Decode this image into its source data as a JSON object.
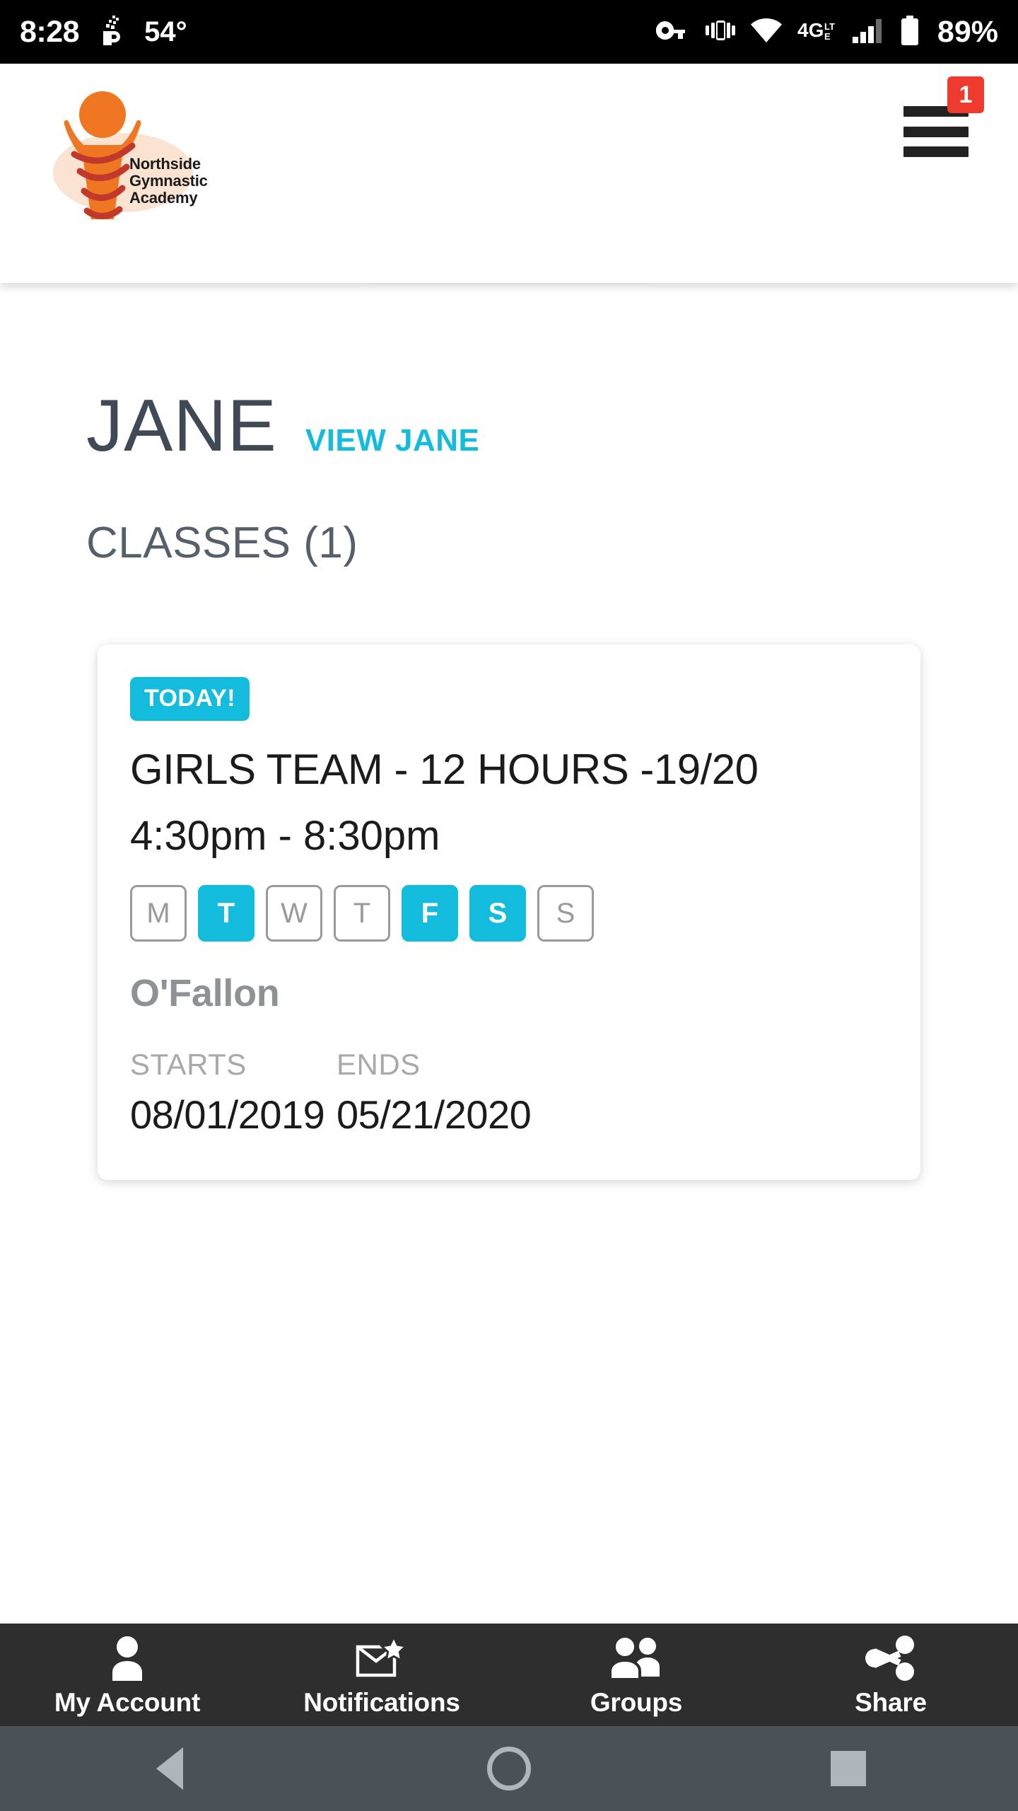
{
  "statusbar": {
    "time": "8:28",
    "temperature": "54°",
    "battery_percent": "89%",
    "icons": [
      "weather-steam-icon",
      "vpn-key-icon",
      "vibrate-icon",
      "wifi-icon",
      "network-4glte-icon",
      "signal-bars-icon",
      "battery-icon"
    ],
    "network_label": "4G",
    "network_sub": "LTE"
  },
  "header": {
    "brand_line1": "Northside",
    "brand_line2": "Gymnastic",
    "brand_line3": "Academy",
    "notification_count": "1",
    "menu_icon": "hamburger-menu-icon"
  },
  "main": {
    "student_name": "JANE",
    "view_link": "VIEW JANE",
    "classes_heading": "CLASSES (1)"
  },
  "class_card": {
    "badge": "TODAY!",
    "title": "GIRLS TEAM - 12 HOURS -19/20",
    "time": "4:30pm - 8:30pm",
    "days": [
      {
        "letter": "M",
        "active": false
      },
      {
        "letter": "T",
        "active": true
      },
      {
        "letter": "W",
        "active": false
      },
      {
        "letter": "T",
        "active": false
      },
      {
        "letter": "F",
        "active": true
      },
      {
        "letter": "S",
        "active": true
      },
      {
        "letter": "S",
        "active": false
      }
    ],
    "location": "O'Fallon",
    "starts_label": "STARTS",
    "starts_value": "08/01/2019",
    "ends_label": "ENDS",
    "ends_value": "05/21/2020"
  },
  "bottomnav": {
    "items": [
      {
        "label": "My Account",
        "icon": "person-icon"
      },
      {
        "label": "Notifications",
        "icon": "envelope-star-icon"
      },
      {
        "label": "Groups",
        "icon": "people-group-icon"
      },
      {
        "label": "Share",
        "icon": "share-nodes-icon"
      }
    ]
  },
  "sysnav": {
    "back": "back-triangle-icon",
    "home": "home-circle-icon",
    "recents": "recents-square-icon"
  },
  "colors": {
    "accent_cyan": "#13bcdd",
    "badge_red": "#ef3b2d",
    "brand_orange": "#ef7722",
    "title_slate": "#3f4a56",
    "nav_dark": "#2e2e2e",
    "sysnav": "#4a5258"
  }
}
